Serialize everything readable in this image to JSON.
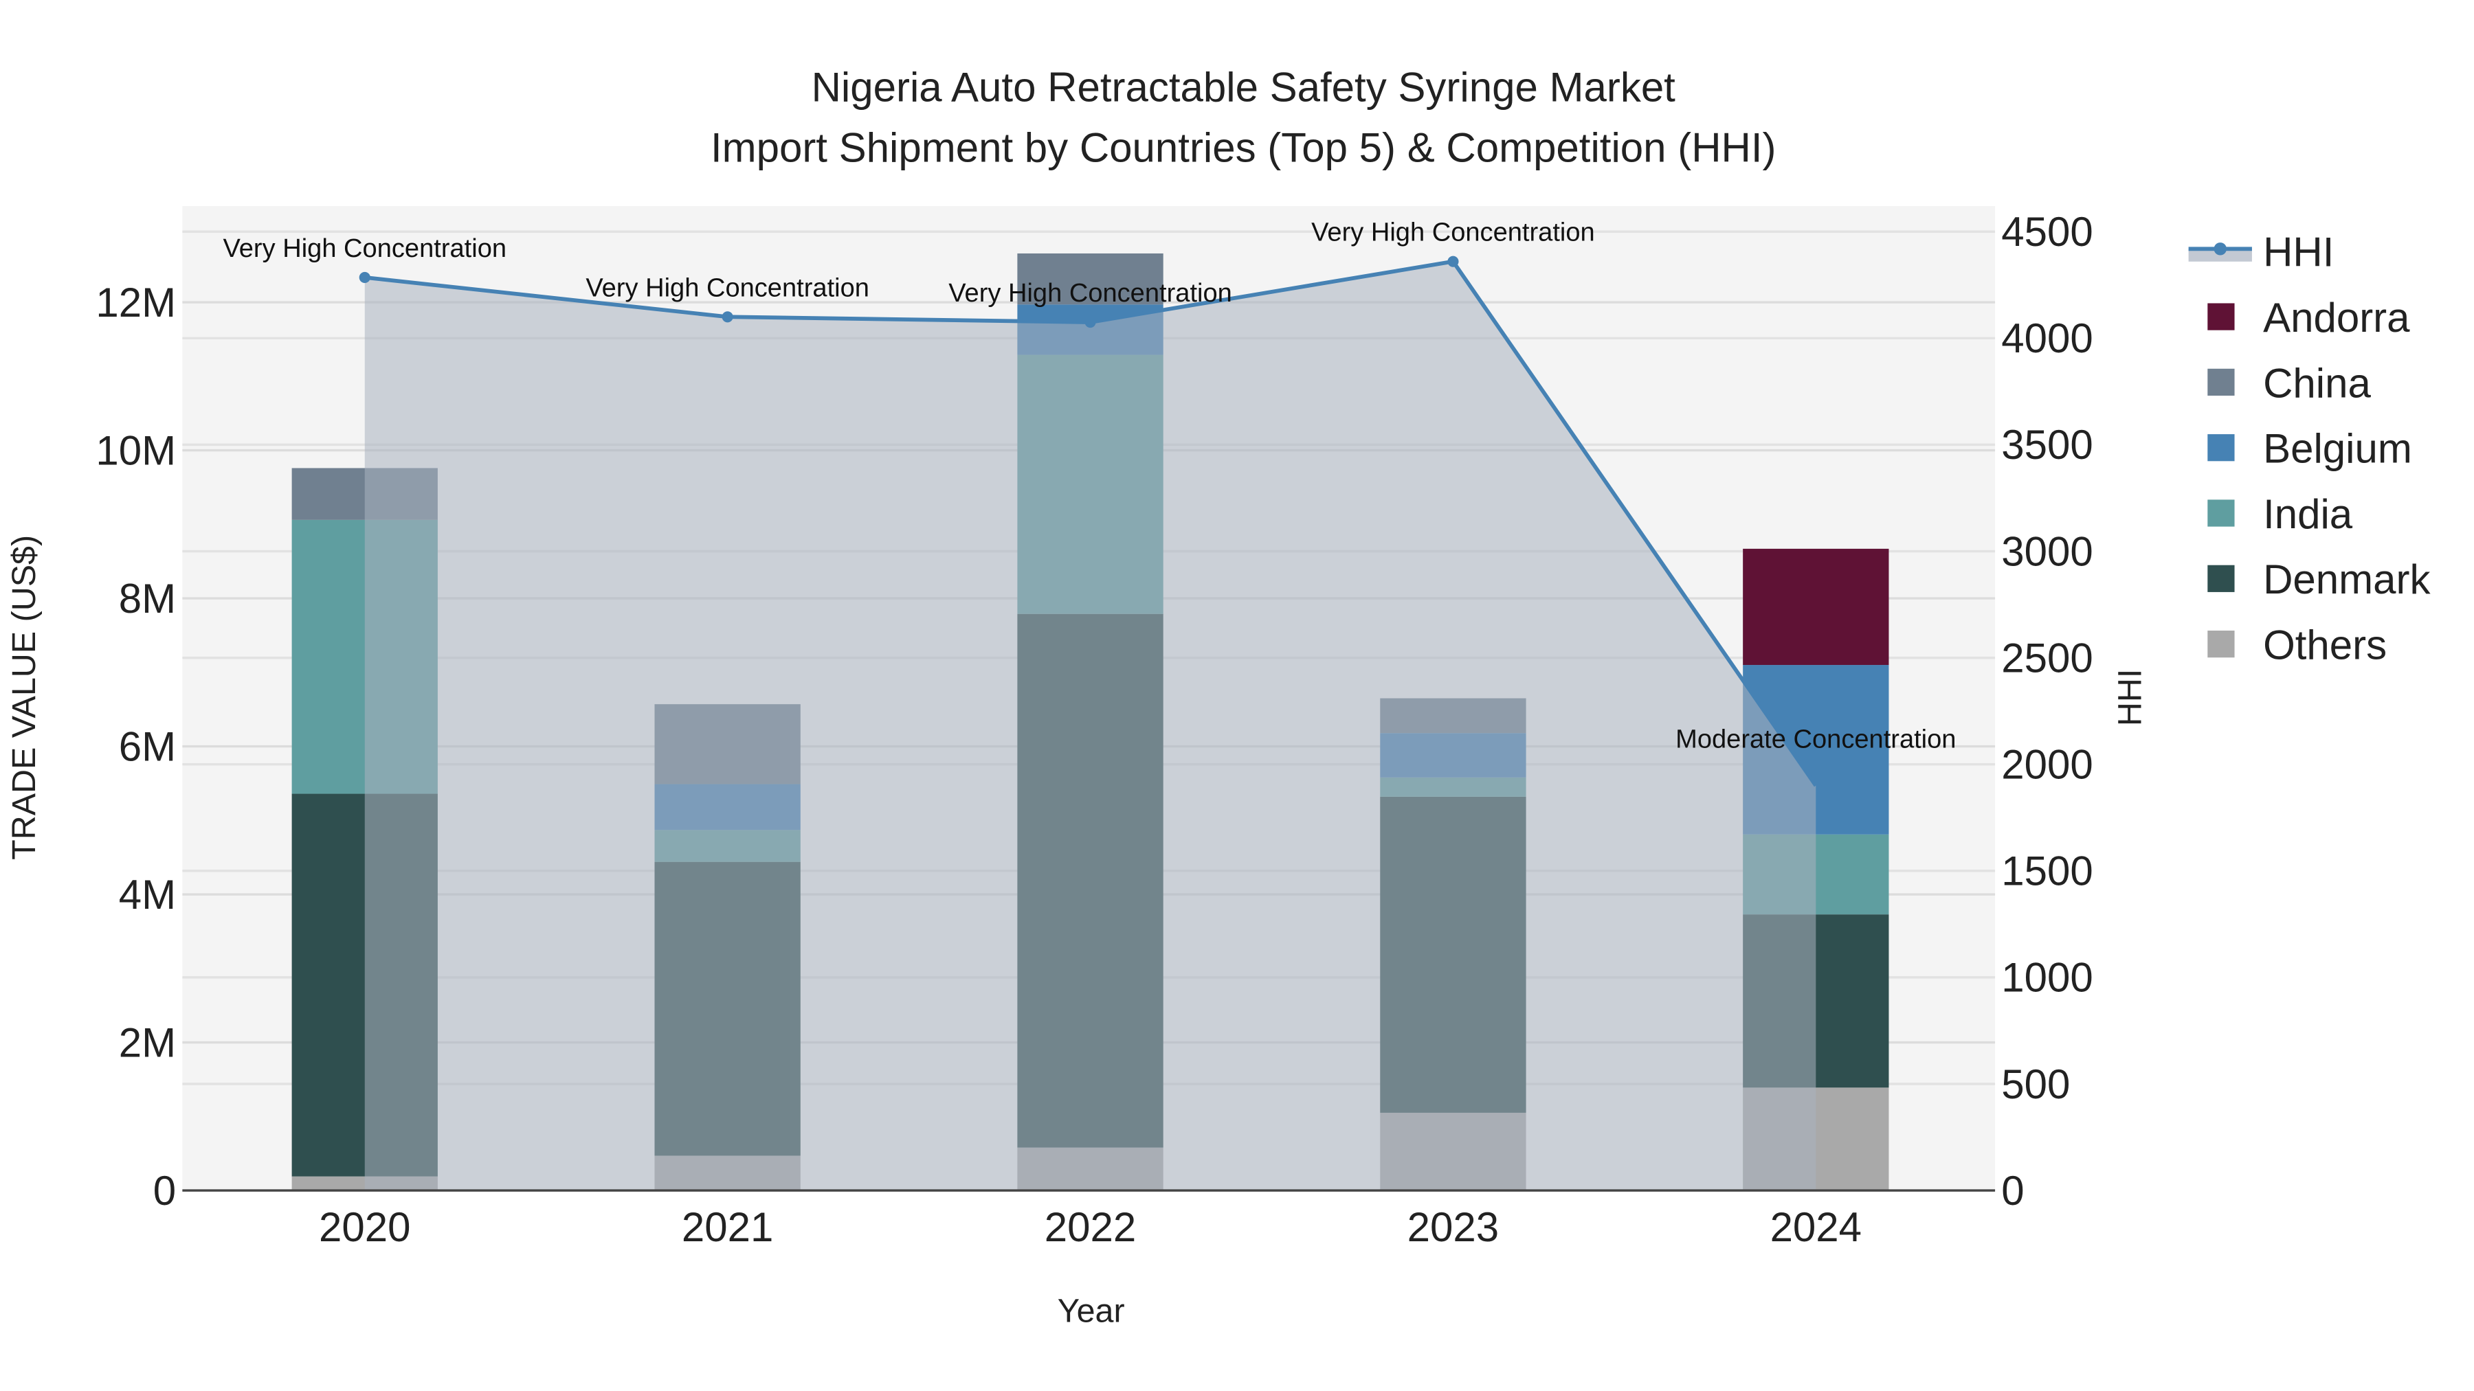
{
  "chart_data": {
    "type": "bar",
    "stacked": true,
    "title_line1": "Nigeria Auto Retractable Safety Syringe Market",
    "title_line2": "Import Shipment by Countries (Top 5) & Competition (HHI)",
    "xlabel": "Year",
    "ylabel": "TRADE VALUE (US$)",
    "y2label": "HHI",
    "categories": [
      "2020",
      "2021",
      "2022",
      "2023",
      "2024"
    ],
    "ylim": [
      0,
      13300000
    ],
    "y2lim": [
      0,
      4620
    ],
    "yticks": [
      0,
      2000000,
      4000000,
      6000000,
      8000000,
      10000000,
      12000000
    ],
    "ytick_labels": [
      "0",
      "2M",
      "4M",
      "6M",
      "8M",
      "10M",
      "12M"
    ],
    "y2ticks": [
      0,
      500,
      1000,
      1500,
      2000,
      2500,
      3000,
      3500,
      4000,
      4500
    ],
    "y2tick_labels": [
      "0",
      "500",
      "1000",
      "1500",
      "2000",
      "2500",
      "3000",
      "3500",
      "4000",
      "4500"
    ],
    "grid": true,
    "legend_placement": "right",
    "series": [
      {
        "name": "Others",
        "color": "#a9a9a9",
        "values": [
          190000,
          470000,
          580000,
          1050000,
          1390000
        ]
      },
      {
        "name": "Denmark",
        "color": "#2f4f4f",
        "values": [
          5170000,
          3970000,
          7210000,
          4270000,
          2340000
        ]
      },
      {
        "name": "India",
        "color": "#5f9ea0",
        "values": [
          3700000,
          430000,
          3500000,
          260000,
          1080000
        ]
      },
      {
        "name": "Belgium",
        "color": "#4682b4",
        "values": [
          0,
          620000,
          680000,
          600000,
          2290000
        ]
      },
      {
        "name": "China",
        "color": "#708090",
        "values": [
          700000,
          1080000,
          690000,
          470000,
          0
        ]
      },
      {
        "name": "Andorra",
        "color": "#5f1235",
        "values": [
          0,
          0,
          0,
          0,
          1570000
        ]
      }
    ],
    "hhi": {
      "name": "HHI",
      "color": "#4682b4",
      "values": [
        4285,
        4100,
        4075,
        4360,
        1900
      ],
      "annotations": [
        "Very High Concentration",
        "Very High Concentration",
        "Very High Concentration",
        "Very High Concentration",
        "Moderate Concentration"
      ]
    },
    "legend_order": [
      "HHI",
      "Andorra",
      "China",
      "Belgium",
      "India",
      "Denmark",
      "Others"
    ]
  }
}
